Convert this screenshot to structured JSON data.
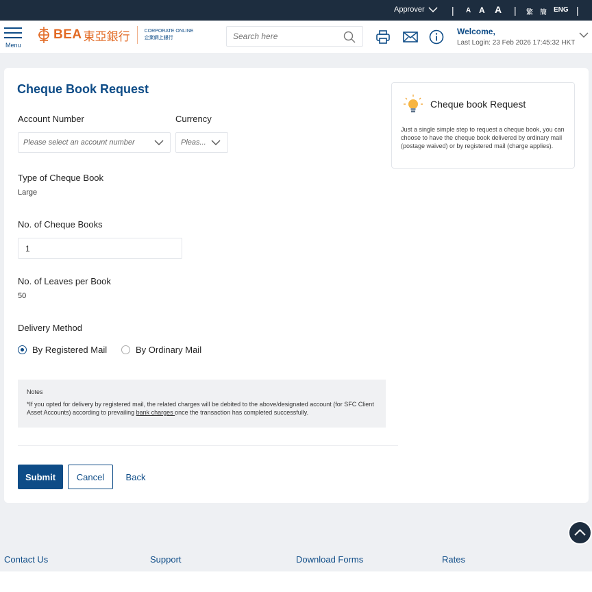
{
  "topbar": {
    "role": "Approver",
    "font_sizes": [
      "A",
      "A",
      "A"
    ],
    "langs": [
      "繁",
      "簡",
      "ENG"
    ]
  },
  "header": {
    "menu_label": "Menu",
    "brand_latin": "BEA",
    "brand_cn": "東亞銀行",
    "product_en": "CORPORATE ONLINE",
    "product_cn": "企業網上銀行",
    "search_placeholder": "Search here",
    "welcome": "Welcome,",
    "last_login": "Last Login: 23 Feb 2026 17:45:32 HKT"
  },
  "form": {
    "title": "Cheque Book Request",
    "account_label": "Account Number",
    "account_placeholder": "Please select an account number",
    "currency_label": "Currency",
    "currency_placeholder": "Pleas...",
    "type_label": "Type of Cheque Book",
    "type_value": "Large",
    "books_label": "No. of Cheque Books",
    "books_value": "1",
    "leaves_label": "No. of Leaves per Book",
    "leaves_value": "50",
    "delivery_label": "Delivery Method",
    "delivery_options": [
      {
        "label": "By Registered Mail",
        "selected": true
      },
      {
        "label": "By Ordinary Mail",
        "selected": false
      }
    ],
    "notes_title": "Notes",
    "notes_text_1": "*If you opted for delivery by registered mail, the related charges will be debited to the above/designated account (for SFC Client Asset Accounts) according to prevailing ",
    "notes_link": "bank charges ",
    "notes_text_2": "once the transaction has completed successfully.",
    "submit": "Submit",
    "cancel": "Cancel",
    "back": "Back"
  },
  "info_box": {
    "title": "Cheque book Request",
    "text": "Just a single simple step to request a cheque book, you can choose to have the cheque book delivered by ordinary mail (postage waived) or by registered mail (charge applies)."
  },
  "footer": {
    "links": [
      "Contact Us",
      "Support",
      "Download Forms",
      "Rates"
    ]
  },
  "colors": {
    "brand_blue": "#0e4c87",
    "brand_orange": "#e26a24",
    "topbar_bg": "#1d2d3f"
  }
}
